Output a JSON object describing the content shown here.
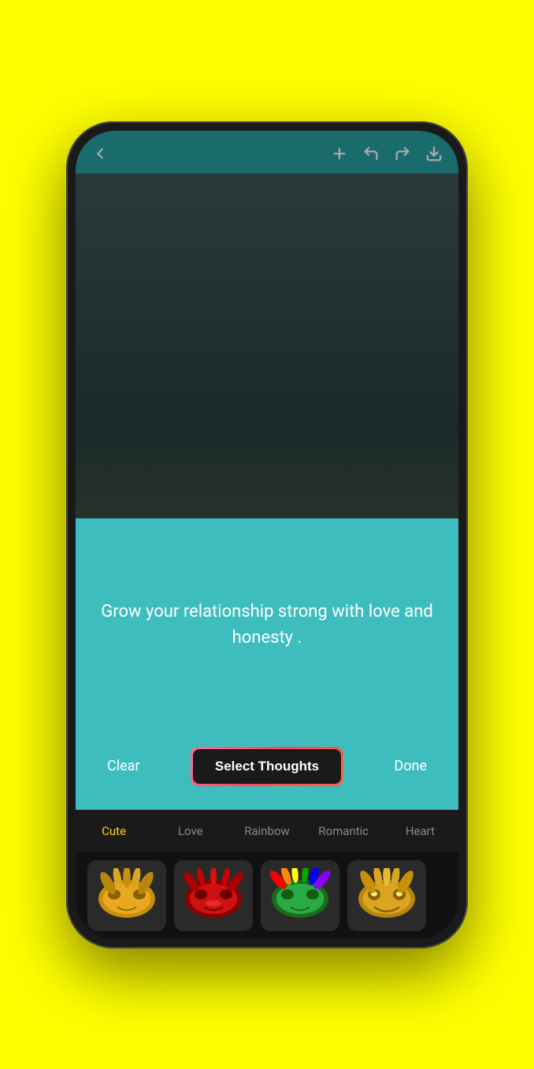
{
  "phone": {
    "background_color": "#FFFF00"
  },
  "toolbar": {
    "back_label": "←",
    "add_label": "+",
    "undo_label": "↺",
    "redo_label": "↻",
    "download_label": "⬇"
  },
  "card": {
    "quote_text": "Grow your relationship strong with love and honesty .",
    "clear_label": "Clear",
    "select_thoughts_label": "Select Thoughts",
    "done_label": "Done"
  },
  "categories": [
    {
      "label": "Cute",
      "active": true
    },
    {
      "label": "Love",
      "active": false
    },
    {
      "label": "Rainbow",
      "active": false
    },
    {
      "label": "Romantic",
      "active": false
    },
    {
      "label": "Heart",
      "active": false
    }
  ],
  "masks": [
    {
      "type": "gold-mask",
      "color": "#C8900A"
    },
    {
      "type": "red-mask",
      "color": "#AA1111"
    },
    {
      "type": "green-mask",
      "color": "#2AAA44"
    },
    {
      "type": "gold-happy-mask",
      "color": "#C8900A"
    }
  ]
}
